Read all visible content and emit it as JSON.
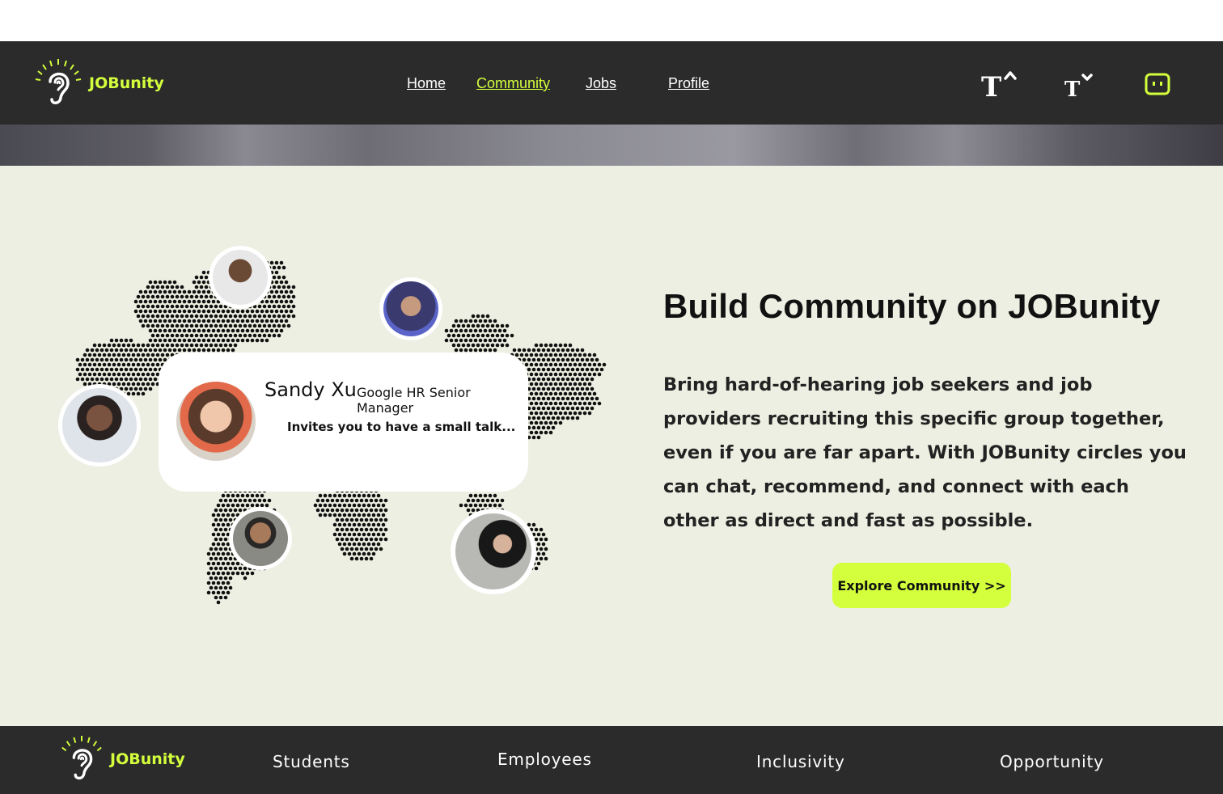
{
  "brand": {
    "name": "JOBunity",
    "accent": "#d4ff3c",
    "dark": "#2b2b2b"
  },
  "nav": {
    "links": [
      {
        "label": "Home",
        "active": false
      },
      {
        "label": "Community",
        "active": true
      },
      {
        "label": "Jobs",
        "active": false
      },
      {
        "label": "Profile",
        "active": false
      }
    ],
    "icons": [
      "font-size-increase-icon",
      "font-size-decrease-icon",
      "chat-icon"
    ]
  },
  "hero": {
    "title": "Build Community on JOBunity",
    "description": "Bring hard-of-hearing job seekers and job providers recruiting this specific group together, even if you are far apart. With JOBunity circles you can chat, recommend, and connect with each other as direct and fast as possible.",
    "cta_label": "Explore Community >>"
  },
  "invite_card": {
    "name": "Sandy Xu",
    "role": "Google HR Senior Manager",
    "message": "Invites you to have a small talk..."
  },
  "footer": {
    "links": [
      "Students",
      "Employees",
      "Inclusivity",
      "Opportunity"
    ]
  }
}
